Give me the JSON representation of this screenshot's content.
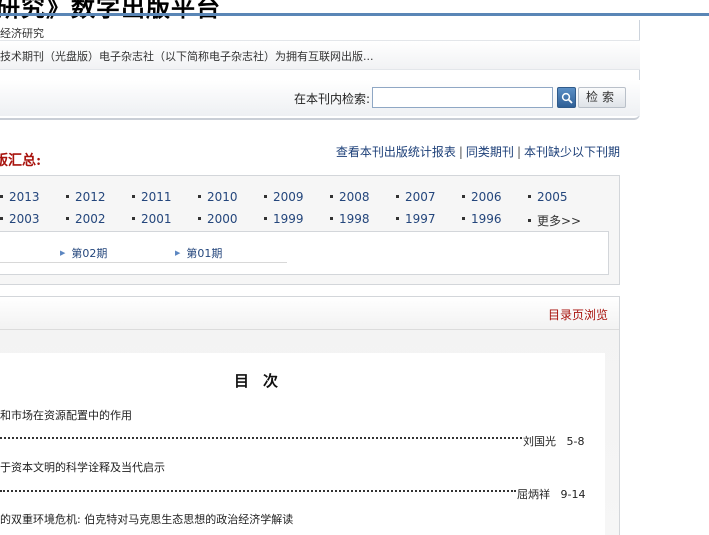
{
  "site": {
    "title": "研究》数字出版平台"
  },
  "info": {
    "breadcrumb": "经济研究",
    "description": "技术期刊（光盘版）电子杂志社（以下简称电子杂志社）为拥有互联网出版...",
    "search_label": "在本刊内检索:",
    "search_value": "",
    "search_button": "检索"
  },
  "summary": {
    "title": "版汇总:",
    "links": [
      "查看本刊出版统计报表",
      "同类期刊",
      "本刊缺少以下刊期"
    ]
  },
  "years": {
    "row1": [
      "2013",
      "2012",
      "2011",
      "2010",
      "2009",
      "2008",
      "2007",
      "2006",
      "2005"
    ],
    "row2": [
      "2003",
      "2002",
      "2001",
      "2000",
      "1999",
      "1998",
      "1997",
      "1996",
      "更多>>"
    ]
  },
  "issues": [
    "第02期",
    "第01期"
  ],
  "toc": {
    "browse_label": "目录页浏览",
    "heading": "目次",
    "articles": [
      {
        "title": "和市场在资源配置中的作用",
        "author": "刘国光",
        "pages": "5-8"
      },
      {
        "title": "于资本文明的科学诠释及当代启示",
        "author": "屈炳祥",
        "pages": "9-14"
      },
      {
        "title": "的双重环境危机: 伯克特对马克思生态思想的政治经济学解读",
        "author": "",
        "pages": ""
      }
    ]
  }
}
